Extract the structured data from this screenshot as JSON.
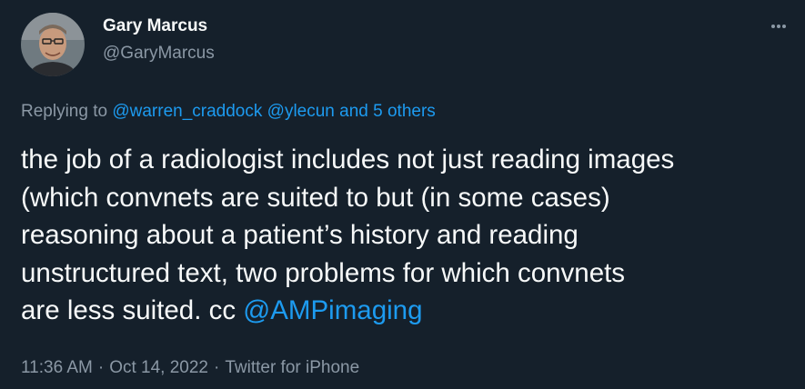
{
  "author": {
    "name": "Gary Marcus",
    "handle": "@GaryMarcus"
  },
  "icons": {
    "more": "more-horizontal-icon",
    "avatar": "profile-photo"
  },
  "reply": {
    "prefix": "Replying to",
    "mention_1": "@warren_craddock",
    "mention_2": "@ylecun",
    "others": "and 5 others"
  },
  "body": {
    "line_1": "the job of a radiologist includes not just reading images",
    "line_2": "(which convnets are suited to but (in some cases)",
    "line_3": "reasoning about a patient’s history and reading",
    "line_4": "unstructured text, two problems for which convnets",
    "line_5_text": "are less suited. cc ",
    "line_5_mention": "@AMPimaging"
  },
  "meta": {
    "time": "11:36 AM",
    "separator": "·",
    "date": "Oct 14, 2022",
    "source": "Twitter for iPhone"
  },
  "colors": {
    "background": "#15202b",
    "text": "#f7f9f9",
    "secondary": "#8b98a5",
    "link": "#1d9bf0"
  }
}
